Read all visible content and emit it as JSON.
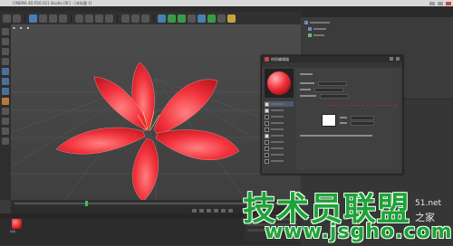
{
  "window": {
    "title": "CINEMA 4D R16.021 Studio (RC) - [未标题 1]",
    "colors": {
      "accent": "#4a7fb5",
      "material_red": "#f2323c"
    }
  },
  "material_editor": {
    "title": "材质编辑器",
    "preview_icon": "sphere-preview",
    "swatch_color": "#ffffff"
  },
  "material_manager": {
    "material_name": "材质"
  },
  "watermark": {
    "brand": "技术员联盟",
    "url": "www.jsgho.com",
    "side_top": "51.net",
    "side_bottom": "之家"
  },
  "icons": {
    "window_close": "close-icon",
    "play": "play-icon"
  }
}
